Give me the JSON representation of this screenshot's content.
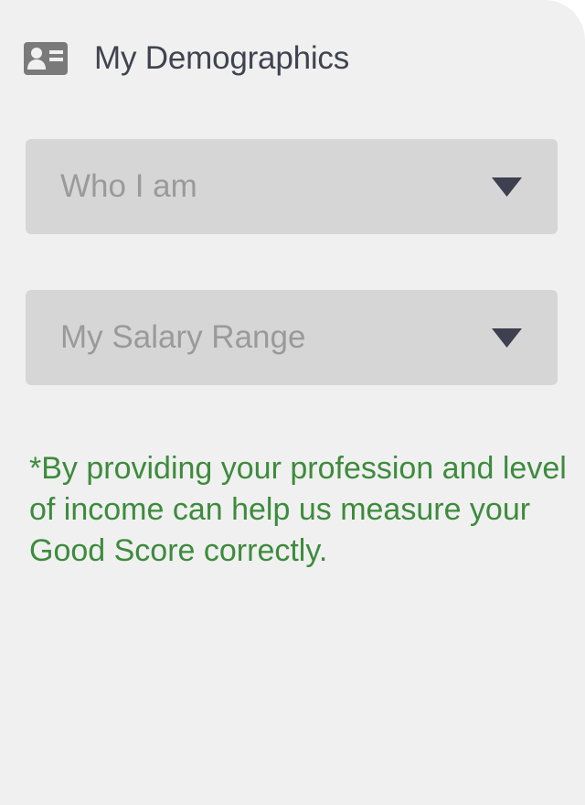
{
  "header": {
    "icon": "id-card-icon",
    "title": "My Demographics"
  },
  "selects": [
    {
      "label": "Who I am",
      "icon": "chevron-down-icon"
    },
    {
      "label": "My Salary Range",
      "icon": "chevron-down-icon"
    }
  ],
  "note": {
    "text": "*By providing your profession and level of income can help us measure your Good Score correctly."
  },
  "colors": {
    "background": "#f0f0f0",
    "select_background": "#d6d6d6",
    "title_text": "#404450",
    "placeholder_text": "#9a9a9a",
    "caret": "#3e4050",
    "note_text": "#3d8b3d"
  }
}
